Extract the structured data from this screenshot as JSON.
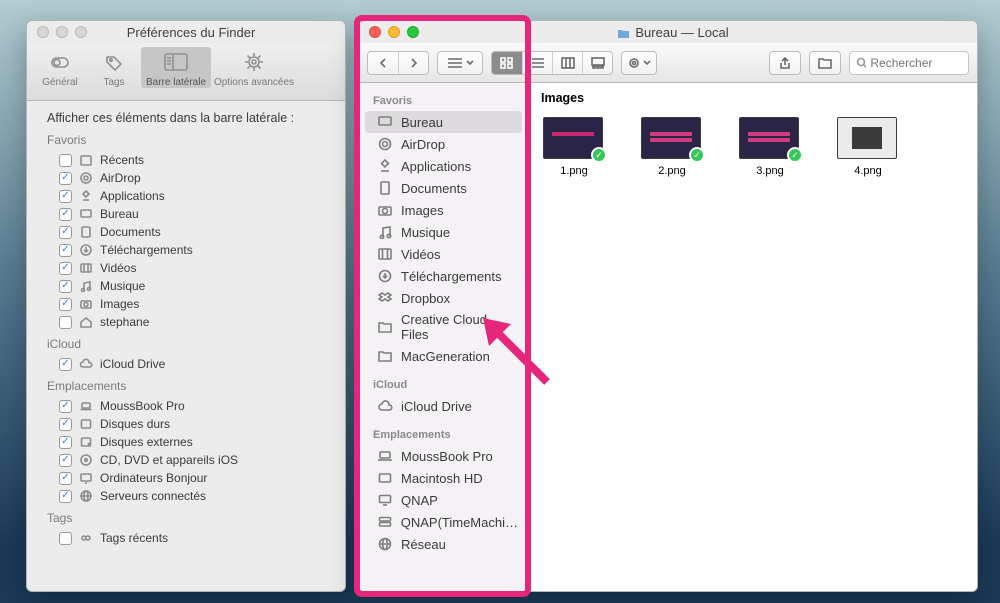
{
  "prefs": {
    "title": "Préférences du Finder",
    "tabs": {
      "general": "Général",
      "tags": "Tags",
      "sidebar": "Barre latérale",
      "advanced": "Options avancées"
    },
    "header": "Afficher ces éléments dans la barre latérale :",
    "groups": {
      "favoris": "Favoris",
      "icloud": "iCloud",
      "emplacements": "Emplacements",
      "tags": "Tags"
    },
    "items": {
      "recents": "Récents",
      "airdrop": "AirDrop",
      "apps": "Applications",
      "bureau": "Bureau",
      "docs": "Documents",
      "dl": "Téléchargements",
      "videos": "Vidéos",
      "music": "Musique",
      "images": "Images",
      "user": "stephane",
      "iclouddrive": "iCloud Drive",
      "moussbook": "MoussBook Pro",
      "disks": "Disques durs",
      "ext": "Disques externes",
      "cd": "CD, DVD et appareils iOS",
      "bonjour": "Ordinateurs Bonjour",
      "servers": "Serveurs connectés",
      "tagsrecent": "Tags récents"
    }
  },
  "finder": {
    "title": "Bureau — Local",
    "search_ph": "Rechercher",
    "breadcrumb": "Images",
    "sidebar": {
      "favoris": "Favoris",
      "icloud": "iCloud",
      "emplacements": "Emplacements",
      "items": {
        "bureau": "Bureau",
        "airdrop": "AirDrop",
        "apps": "Applications",
        "docs": "Documents",
        "images": "Images",
        "music": "Musique",
        "videos": "Vidéos",
        "dl": "Téléchargements",
        "dropbox": "Dropbox",
        "ccf": "Creative Cloud Files",
        "macg": "MacGeneration",
        "iclouddrive": "iCloud Drive",
        "moussbook": "MoussBook Pro",
        "machd": "Macintosh HD",
        "qnap": "QNAP",
        "qnaptm": "QNAP(TimeMachi…",
        "reseau": "Réseau"
      }
    },
    "files": {
      "f1": "1.png",
      "f2": "2.png",
      "f3": "3.png",
      "f4": "4.png"
    }
  }
}
